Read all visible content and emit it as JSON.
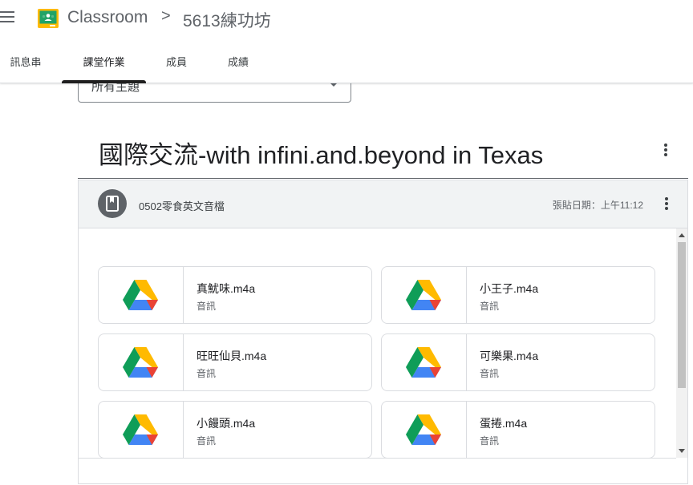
{
  "header": {
    "app_title": "Classroom",
    "separator": ">",
    "class_name": "5613練功坊"
  },
  "tabs": [
    {
      "label": "訊息串",
      "active": false
    },
    {
      "label": "課堂作業",
      "active": true
    },
    {
      "label": "成員",
      "active": false
    },
    {
      "label": "成績",
      "active": false
    }
  ],
  "topic_filter": {
    "value": "所有主題"
  },
  "section": {
    "title": "國際交流-with infini.and.beyond in Texas"
  },
  "assignment": {
    "title": "0502零食英文音檔",
    "posted": "張貼日期：上午11:12",
    "attachments": [
      {
        "name": "真魷味.m4a",
        "type": "音訊"
      },
      {
        "name": "小王子.m4a",
        "type": "音訊"
      },
      {
        "name": "旺旺仙貝.m4a",
        "type": "音訊"
      },
      {
        "name": "可樂果.m4a",
        "type": "音訊"
      },
      {
        "name": "小饅頭.m4a",
        "type": "音訊"
      },
      {
        "name": "蛋捲.m4a",
        "type": "音訊"
      }
    ]
  },
  "icons": {
    "menu": "hamburger-menu-icon",
    "logo": "google-classroom-logo",
    "more": "more-vert-icon",
    "assignment": "book-icon",
    "attachment": "google-drive-icon"
  }
}
